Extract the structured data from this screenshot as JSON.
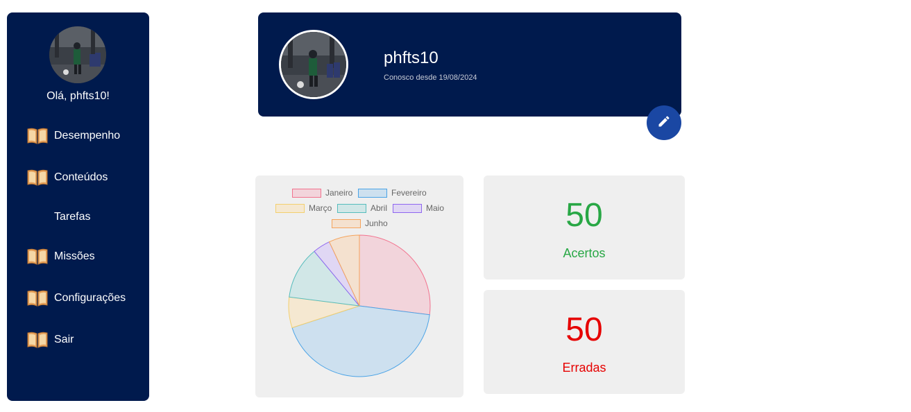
{
  "sidebar": {
    "greeting": "Olá, phfts10!",
    "items": [
      {
        "label": "Desempenho",
        "icon": "book-icon"
      },
      {
        "label": "Conteúdos",
        "icon": "book-icon"
      },
      {
        "label": "Tarefas",
        "icon": ""
      },
      {
        "label": "Missões",
        "icon": "book-icon"
      },
      {
        "label": "Configurações",
        "icon": "book-icon"
      },
      {
        "label": "Sair",
        "icon": "book-icon"
      }
    ]
  },
  "profile": {
    "username": "phfts10",
    "member_since": "Conosco desde 19/08/2024",
    "edit_icon": "pencil-icon"
  },
  "stats": {
    "acertos": {
      "value": "50",
      "label": "Acertos",
      "color": "#28a745"
    },
    "erradas": {
      "value": "50",
      "label": "Erradas",
      "color": "#e60000"
    }
  },
  "colors": {
    "navy": "#001a4d",
    "edit_button": "#1a47a3",
    "card_bg": "#efefef",
    "book_icon": "#e6a15c"
  },
  "chart_data": {
    "type": "pie",
    "categories": [
      "Janeiro",
      "Fevereiro",
      "Março",
      "Abril",
      "Maio",
      "Junho"
    ],
    "values": [
      27,
      43,
      7,
      12,
      4,
      7
    ],
    "colors": [
      {
        "fill": "#f2d4db",
        "stroke": "#f2728e"
      },
      {
        "fill": "#cde0ef",
        "stroke": "#4aa3e6"
      },
      {
        "fill": "#f5e8d1",
        "stroke": "#f3cf6e"
      },
      {
        "fill": "#d1e7e7",
        "stroke": "#55bcbc"
      },
      {
        "fill": "#e0d7f4",
        "stroke": "#8f66f0"
      },
      {
        "fill": "#f4e1cf",
        "stroke": "#f5a35b"
      }
    ],
    "legend": "top"
  }
}
